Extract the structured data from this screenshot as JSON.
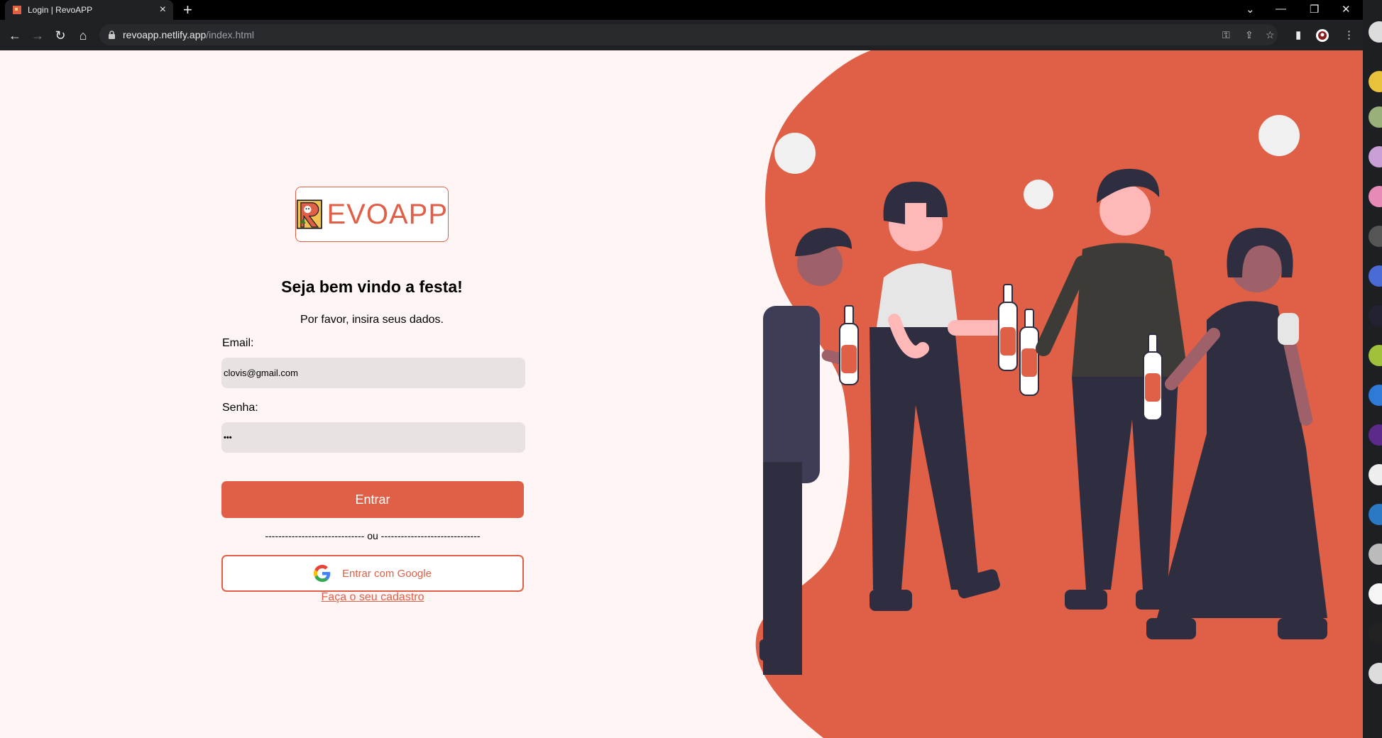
{
  "browser": {
    "tab_title": "Login | RevoAPP",
    "new_tab": "+",
    "url_host": "revoapp.netlify.app",
    "url_path": "/index.html"
  },
  "login": {
    "logo_letter": "R",
    "logo_text": "EVOAPP",
    "heading": "Seja bem vindo a festa!",
    "subtitle": "Por favor, insira seus dados.",
    "email_label": "Email:",
    "email_value": "clovis@gmail.com",
    "password_label": "Senha:",
    "password_value": "•••",
    "submit_label": "Entrar",
    "divider": "------------------------------ ou ------------------------------",
    "google_label": "Entrar com Google",
    "signup_link": "Faça o seu cadastro"
  },
  "colors": {
    "accent": "#df6046",
    "page_background": "#fff5f5",
    "input_background": "#e8e2e2",
    "figure_dark": "#2f2e41"
  },
  "icons": [
    "back-icon",
    "forward-icon",
    "reload-icon",
    "home-icon",
    "lock-icon",
    "key-icon",
    "share-icon",
    "star-icon",
    "sidepanel-icon",
    "profile-icon",
    "menu-icon",
    "google-icon"
  ]
}
